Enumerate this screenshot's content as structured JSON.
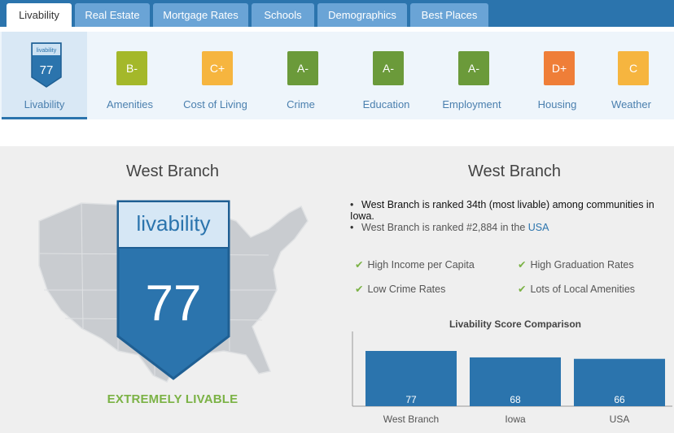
{
  "tabs": [
    {
      "label": "Livability",
      "active": true
    },
    {
      "label": "Real Estate",
      "active": false
    },
    {
      "label": "Mortgage Rates",
      "active": false
    },
    {
      "label": "Schools",
      "active": false
    },
    {
      "label": "Demographics",
      "active": false
    },
    {
      "label": "Best Places",
      "active": false
    }
  ],
  "categories": [
    {
      "label": "Livability",
      "grade": "77",
      "color": "#2b74ad",
      "active": true,
      "shield_text": "livability"
    },
    {
      "label": "Amenities",
      "grade": "B-",
      "color": "#a4b82a"
    },
    {
      "label": "Cost of Living",
      "grade": "C+",
      "color": "#f6b53f"
    },
    {
      "label": "Crime",
      "grade": "A-",
      "color": "#6b9a3a"
    },
    {
      "label": "Education",
      "grade": "A-",
      "color": "#6b9a3a"
    },
    {
      "label": "Employment",
      "grade": "A-",
      "color": "#6b9a3a"
    },
    {
      "label": "Housing",
      "grade": "D+",
      "color": "#ef7e38"
    },
    {
      "label": "Weather",
      "grade": "C",
      "color": "#f6b53f"
    }
  ],
  "main": {
    "left_title": "West Branch",
    "right_title": "West Branch",
    "shield_brand": "livability",
    "score": "77",
    "verdict": "EXTREMELY LIVABLE",
    "rank_line": "West Branch is ranked 34th (most livable) among communities in Iowa.",
    "rank_usa_prefix": "West Branch is ranked #2,884 in the",
    "rank_usa_link": "USA",
    "features": [
      "High Income per Capita",
      "High Graduation Rates",
      "Low Crime Rates",
      "Lots of Local Amenities"
    ]
  },
  "chart_data": {
    "type": "bar",
    "title": "Livability Score Comparison",
    "categories": [
      "West Branch",
      "Iowa",
      "USA"
    ],
    "values": [
      77,
      68,
      66
    ],
    "color": "#2b74ad",
    "xlabel": "",
    "ylabel": ""
  }
}
